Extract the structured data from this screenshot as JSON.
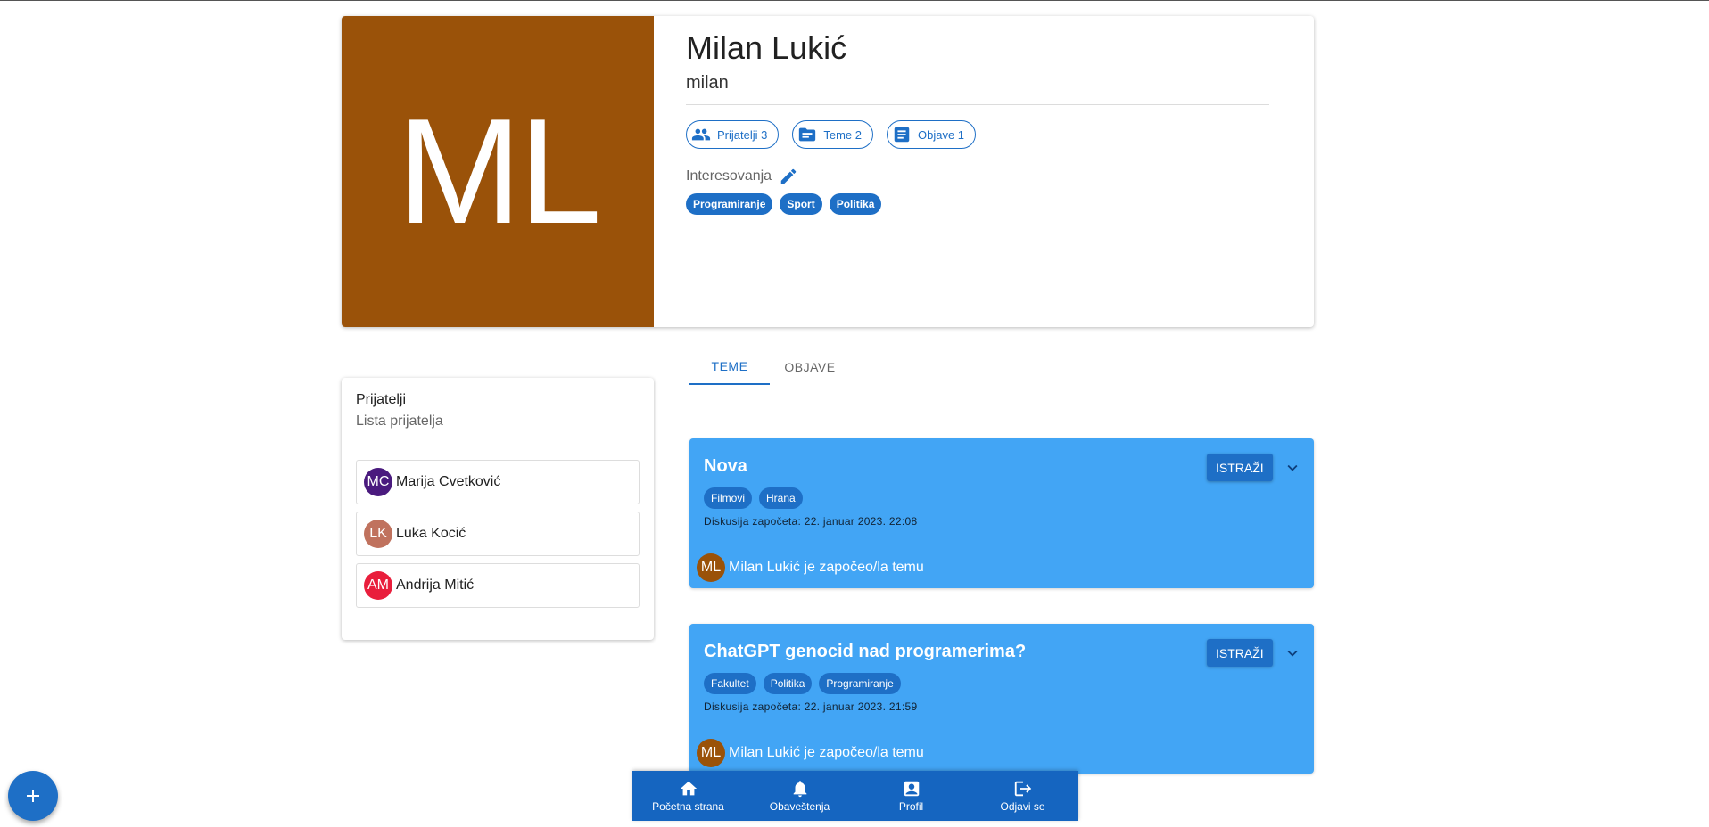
{
  "profile": {
    "initials": "ML",
    "avatar_color": "#9a5209",
    "name": "Milan Lukić",
    "username": "milan",
    "stats": [
      {
        "icon": "people-icon",
        "label": "Prijatelji 3"
      },
      {
        "icon": "topic-icon",
        "label": "Teme 2"
      },
      {
        "icon": "article-icon",
        "label": "Objave 1"
      }
    ],
    "interests_label": "Interesovanja",
    "interests": [
      "Programiranje",
      "Sport",
      "Politika"
    ]
  },
  "friends": {
    "title": "Prijatelji",
    "subtitle": "Lista prijatelja",
    "items": [
      {
        "initials": "MC",
        "name": "Marija Cvetković",
        "color": "#4a1a7e"
      },
      {
        "initials": "LK",
        "name": "Luka Kocić",
        "color": "#c0725e"
      },
      {
        "initials": "AM",
        "name": "Andrija Mitić",
        "color": "#e91e3c"
      }
    ]
  },
  "tabs": [
    "TEME",
    "OBJAVE"
  ],
  "topics": [
    {
      "title": "Nova",
      "explore_label": "ISTRAŽI",
      "tags": [
        "Filmovi",
        "Hrana"
      ],
      "date": "Diskusija započeta: 22. januar 2023. 22:08",
      "author_initials": "ML",
      "author_text": "Milan Lukić je započeo/la temu"
    },
    {
      "title": "ChatGPT genocid nad programerima?",
      "explore_label": "ISTRAŽI",
      "tags": [
        "Fakultet",
        "Politika",
        "Programiranje"
      ],
      "date": "Diskusija započeta: 22. januar 2023. 21:59",
      "author_initials": "ML",
      "author_text": "Milan Lukić je započeo/la temu"
    }
  ],
  "bottom_nav": [
    {
      "icon": "home-icon",
      "label": "Početna strana"
    },
    {
      "icon": "bell-icon",
      "label": "Obaveštenja"
    },
    {
      "icon": "profile-icon",
      "label": "Profil"
    },
    {
      "icon": "logout-icon",
      "label": "Odjavi se"
    }
  ],
  "fab": {
    "icon": "plus-icon"
  },
  "colors": {
    "primary": "#1e6fc6",
    "card_blue": "#42a5f5",
    "nav_blue": "#1565c0"
  }
}
